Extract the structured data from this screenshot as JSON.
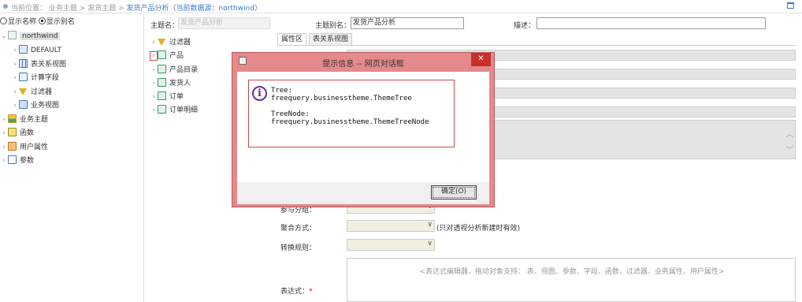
{
  "breadcrumb": {
    "prefix": "当前位置：",
    "items": [
      "业务主题",
      "发货主题"
    ],
    "sep": ">",
    "current": "发货产品分析（当前数据源：northwind）"
  },
  "left": {
    "radio1": "显示名称",
    "radio2": "显示别名",
    "tree": [
      {
        "label": "northwind",
        "icon": "database-icon"
      },
      {
        "label": "DEFAULT",
        "icon": "table-icon"
      },
      {
        "label": "表关系视图",
        "icon": "relation-icon"
      },
      {
        "label": "计算字段",
        "icon": "calc-field-icon"
      },
      {
        "label": "过滤器",
        "icon": "filter-icon"
      },
      {
        "label": "业务视图",
        "icon": "view-icon"
      },
      {
        "label": "业务主题",
        "icon": "theme-icon"
      },
      {
        "label": "函数",
        "icon": "function-icon"
      },
      {
        "label": "用户属性",
        "icon": "user-prop-icon"
      },
      {
        "label": "参数",
        "icon": "param-icon"
      }
    ]
  },
  "mid": {
    "tree": [
      {
        "label": "过滤器"
      },
      {
        "label": "产品"
      },
      {
        "label": "产品目录"
      },
      {
        "label": "发货人"
      },
      {
        "label": "订单"
      },
      {
        "label": "订单明细"
      }
    ]
  },
  "form": {
    "name_label": "主题名：",
    "name_value": "发货产品分析",
    "alias_label": "主题别名：",
    "alias_value": "发货产品分析",
    "desc_label": "描述：",
    "tab1": "属性区",
    "tab2": "表关系视图",
    "group_label": "参与分组：",
    "agg_label": "聚合方式：",
    "agg_note": "(只对透视分析新建时有效)",
    "convert_label": "转换规则：",
    "expr_label": "表达式：",
    "expr_required": "*",
    "expr_hint": "<表达式编辑器，拖动对象支持： 表、视图、参数、字段、函数、过滤器、业务属性、用户属性>"
  },
  "dialog": {
    "title": "提示信息 -- 网页对话框",
    "close": "✕",
    "message": "Tree:\nfreequery.businesstheme.ThemeTree\n\nTreeNode:\nfreequery.businesstheme.ThemeTreeNode",
    "ok": "确定(O)"
  },
  "colors": {
    "accent": "#3a7ac8",
    "dialog_frame": "#e4898c",
    "close": "#c7302b"
  }
}
